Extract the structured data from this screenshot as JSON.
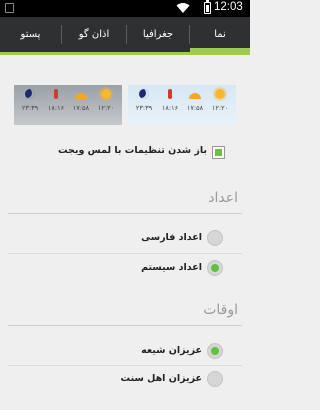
{
  "status_bar": {
    "time": "12:03",
    "icons": [
      "wifi-icon",
      "battery-icon",
      "notification-icon"
    ]
  },
  "tabs": [
    {
      "label": "نما",
      "active": true
    },
    {
      "label": "جغرافیا",
      "active": false
    },
    {
      "label": "اذان گو",
      "active": false
    },
    {
      "label": "پستو",
      "active": false
    }
  ],
  "widget_preview": {
    "times": [
      "۱۲:۲۰",
      "۱۷:۵۸",
      "۱۸:۱۶",
      "۲۳:۳۹"
    ]
  },
  "options": {
    "open_settings_label": "باز شدن تنظیمات با لمس ویجت",
    "open_settings_checked": true
  },
  "numbers_section": {
    "title": "اعداد",
    "items": [
      {
        "label": "اعداد فارسی",
        "selected": false
      },
      {
        "label": "اعداد سیستم",
        "selected": true
      }
    ]
  },
  "times_section": {
    "title": "اوقات",
    "items": [
      {
        "label": "عزیزان شیعه",
        "selected": true
      },
      {
        "label": "عزیزان اهل سنت",
        "selected": false
      }
    ]
  },
  "colors": {
    "accent": "#9fca4b",
    "check": "#6cc04a",
    "tabbar": "#2e3031"
  }
}
